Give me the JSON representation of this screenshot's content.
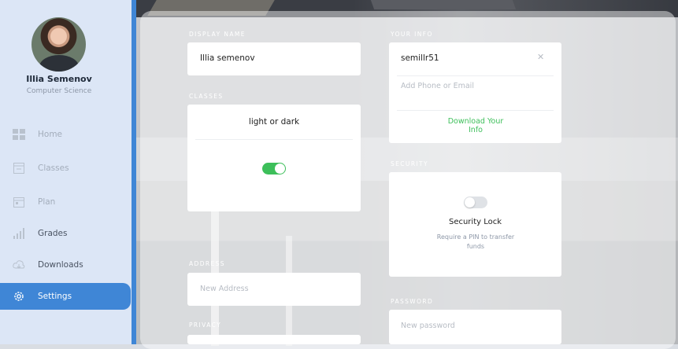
{
  "user": {
    "name": "Illia Semenov",
    "department": "Computer Science"
  },
  "nav": {
    "items": [
      {
        "label": "Home",
        "icon": "dashboard-icon"
      },
      {
        "label": "Classes",
        "icon": "classes-icon"
      },
      {
        "label": "Plan",
        "icon": "calendar-icon"
      },
      {
        "label": "Grades",
        "icon": "bar-chart-icon"
      },
      {
        "label": "Downloads",
        "icon": "cloud-download-icon"
      },
      {
        "label": "Settings",
        "icon": "gear-icon"
      }
    ],
    "active": "Settings"
  },
  "settings": {
    "display_name": {
      "label": "DISPLAY NAME",
      "value": "Illia semenov"
    },
    "classes": {
      "label": "CLASSES",
      "theme_text": "light or dark",
      "toggle_on": true
    },
    "address": {
      "label": "ADDRESS",
      "placeholder": "New Address"
    },
    "privacy": {
      "label": "PRIVACY"
    },
    "your_info": {
      "label": "YOUR INFO",
      "username": "semillr51",
      "phone_placeholder": "Add Phone or Email",
      "download_link": "Download Your Info"
    },
    "security": {
      "label": "SECURITY",
      "toggle_on": false,
      "title": "Security Lock",
      "description": "Require a PIN to transfer funds"
    },
    "password": {
      "label": "PASSWORD",
      "placeholder": "New password"
    }
  },
  "colors": {
    "accent": "#3f86d6",
    "toggle_on": "#3dbf5a",
    "toggle_off": "#dfe2e6",
    "link": "#3dbf5a"
  }
}
